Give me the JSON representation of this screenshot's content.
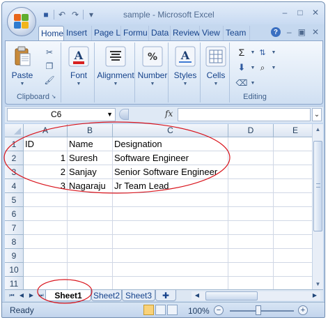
{
  "window": {
    "title": "sample - Microsoft Excel",
    "controls": [
      "–",
      "□",
      "✕"
    ]
  },
  "quick_access": {
    "icons": [
      "save-icon",
      "undo-icon",
      "redo-icon",
      "customize-icon"
    ],
    "glyphs": [
      "■",
      "↶",
      "↷",
      "▾"
    ]
  },
  "ribbon_tabs": [
    "Home",
    "Insert",
    "Page L",
    "Formu",
    "Data",
    "Review",
    "View",
    "Team"
  ],
  "ribbon_right": [
    "–",
    "▣",
    "✕"
  ],
  "ribbon_groups": {
    "clipboard": {
      "paste_label": "Paste",
      "group_label": "Clipboard"
    },
    "font": {
      "label": "Font"
    },
    "alignment": {
      "label": "Alignment"
    },
    "number": {
      "label": "Number"
    },
    "styles": {
      "label": "Styles"
    },
    "cells": {
      "label": "Cells"
    },
    "editing": {
      "label": "Editing"
    }
  },
  "formula_bar": {
    "name_box": "C6",
    "fx": "fx",
    "formula": ""
  },
  "sheet": {
    "columns": [
      "A",
      "B",
      "C",
      "D",
      "E"
    ],
    "rows": [
      "1",
      "2",
      "3",
      "4",
      "5",
      "6",
      "7",
      "8",
      "9",
      "10",
      "11"
    ],
    "data": [
      [
        "ID",
        "Name",
        "Designation"
      ],
      [
        "1",
        "Suresh",
        "Software Engineer"
      ],
      [
        "2",
        "Sanjay",
        "Senior Software Engineer"
      ],
      [
        "3",
        "Nagaraju",
        "Jr Team Lead"
      ]
    ]
  },
  "sheet_tabs": [
    "Sheet1",
    "Sheet2",
    "Sheet3"
  ],
  "active_sheet": "Sheet1",
  "status_bar": {
    "ready": "Ready",
    "zoom": "100%",
    "zoom_out": "−",
    "zoom_in": "+"
  },
  "annotation_color": "#d9141c"
}
